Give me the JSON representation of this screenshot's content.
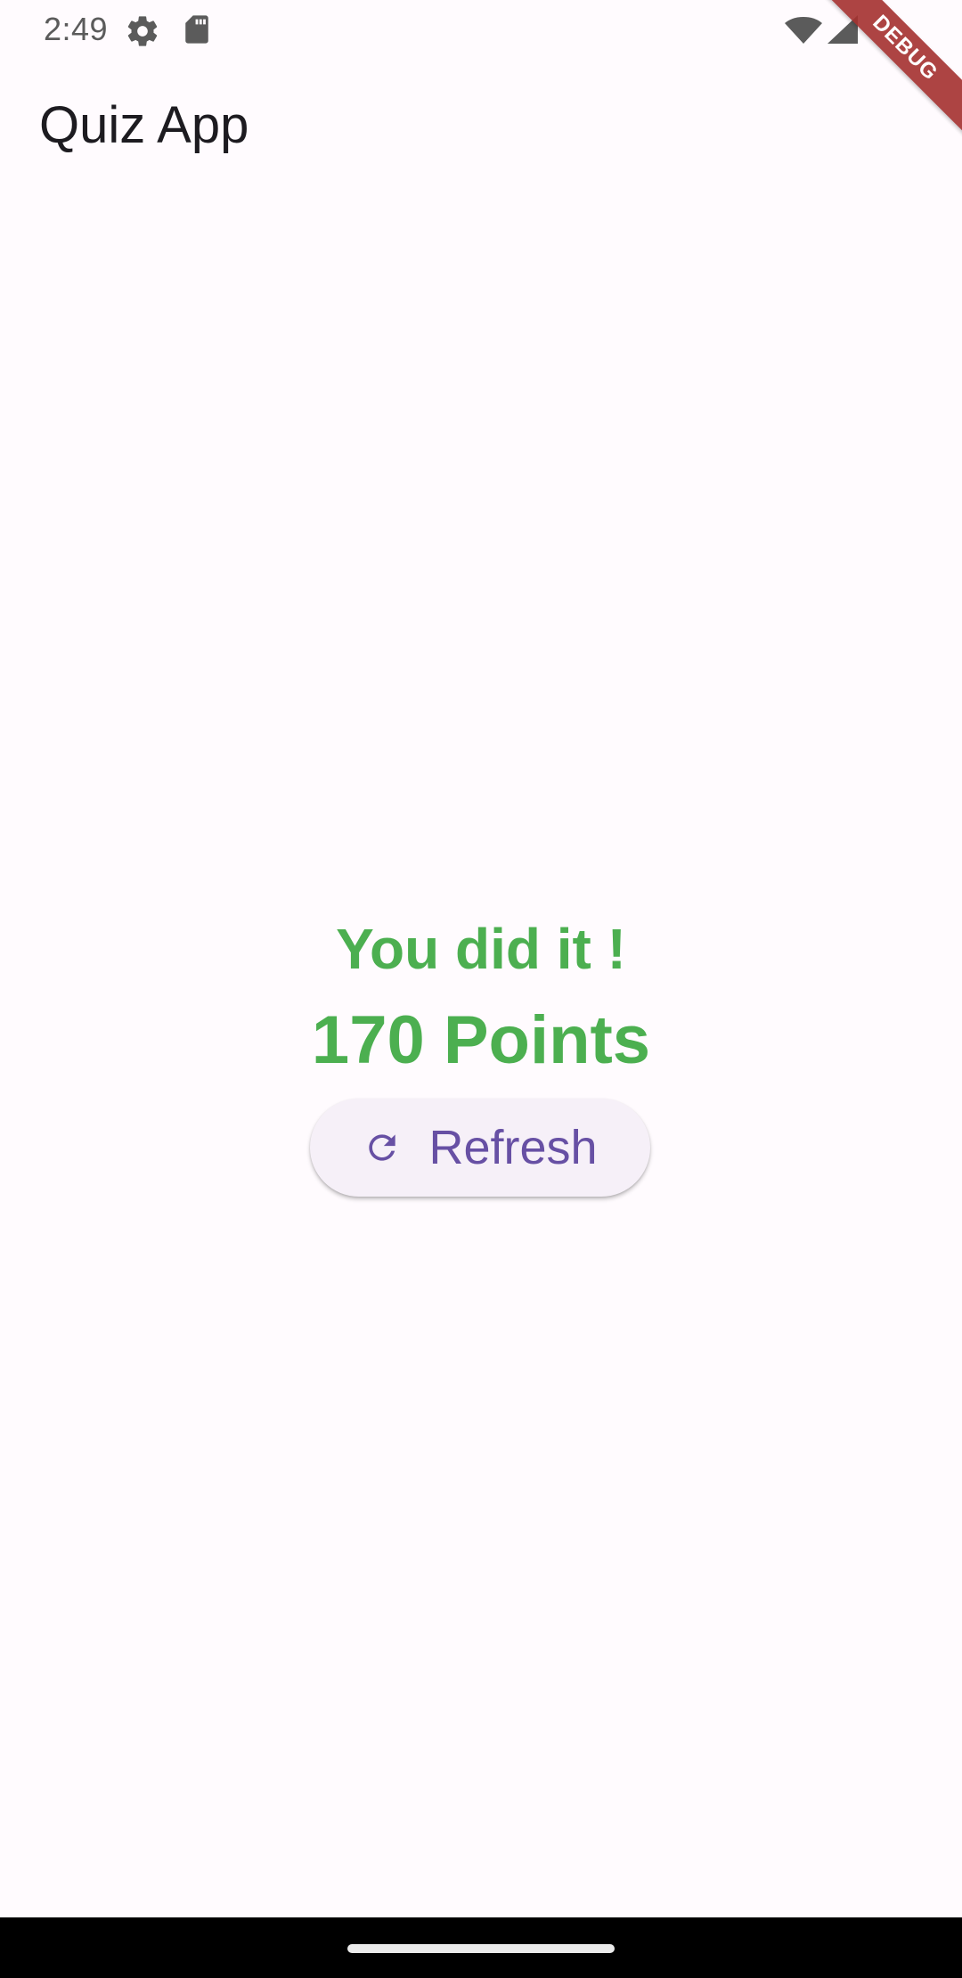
{
  "status_bar": {
    "time": "2:49",
    "icons": [
      "gear-icon",
      "sd-card-icon",
      "wifi-icon",
      "signal-icon"
    ]
  },
  "debug_banner": {
    "label": "DEBUG",
    "color": "#a5312f"
  },
  "app_bar": {
    "title": "Quiz App"
  },
  "result": {
    "message": "You did it !",
    "points": "170 Points",
    "color": "#4caf50"
  },
  "refresh_button": {
    "icon": "refresh-icon",
    "label": "Refresh",
    "color": "#6750a4"
  },
  "navigation_bar": {
    "handle": "home-handle"
  }
}
